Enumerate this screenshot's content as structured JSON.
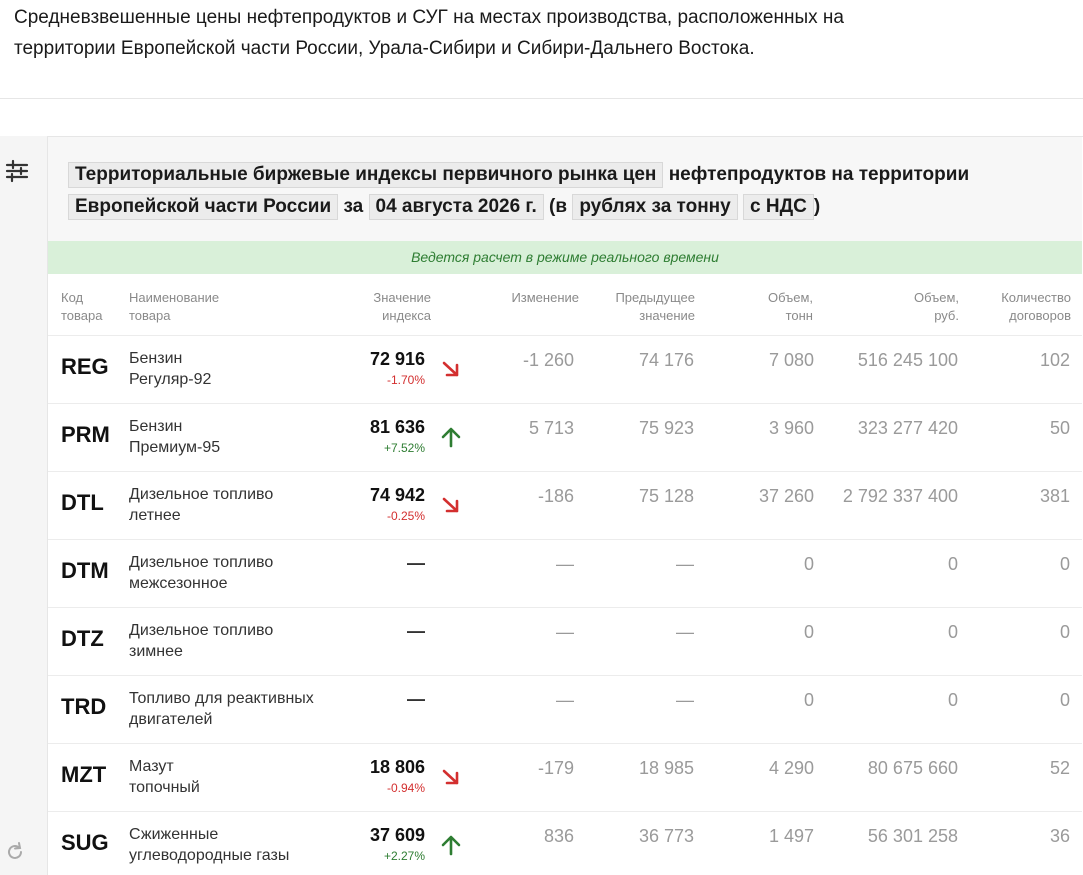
{
  "intro": {
    "line1": "Средневзвешенные цены нефтепродуктов и СУГ на местах производства, расположенных на",
    "line2": "территории Европейской части России, Урала-Сибири и Сибири-Дальнего Востока."
  },
  "icons": {
    "filter": "sliders-icon",
    "refresh": "refresh-icon"
  },
  "title": {
    "index_select": "Территориальные биржевые индексы первичного рынка цен",
    "text_middle": "нефтепродуктов на территории",
    "region_select": "Европейской части России",
    "text_za": "за",
    "date_select": "04 августа 2026 г.",
    "paren_open": "(в",
    "unit_select": "рублях за тонну",
    "vat_select": "с НДС",
    "paren_close": ")"
  },
  "banner": "Ведется расчет в режиме реального времени",
  "columns": {
    "code": [
      "Код",
      "товара"
    ],
    "name": [
      "Наименование",
      "товара"
    ],
    "index": [
      "Значение",
      "индекса"
    ],
    "change": [
      "Изменение",
      ""
    ],
    "prev": [
      "Предыдущее",
      "значение"
    ],
    "vol_t": [
      "Объем,",
      "тонн"
    ],
    "vol_rub": [
      "Объем,",
      "руб."
    ],
    "contracts": [
      "Количество",
      "договоров"
    ]
  },
  "colors": {
    "up": "#2e7d32",
    "down": "#d32f2f",
    "banner_bg": "#d9f0d9"
  },
  "rows": [
    {
      "code": "REG",
      "name1": "Бензин",
      "name2": "Регуляр-92",
      "value": "72 916",
      "pct": "-1.70%",
      "trend": "down",
      "change": "-1 260",
      "prev": "74 176",
      "vol_t": "7 080",
      "vol_rub": "516 245 100",
      "contracts": "102"
    },
    {
      "code": "PRM",
      "name1": "Бензин",
      "name2": "Премиум-95",
      "value": "81 636",
      "pct": "+7.52%",
      "trend": "up",
      "change": "5 713",
      "prev": "75 923",
      "vol_t": "3 960",
      "vol_rub": "323 277 420",
      "contracts": "50"
    },
    {
      "code": "DTL",
      "name1": "Дизельное топливо",
      "name2": "летнее",
      "value": "74 942",
      "pct": "-0.25%",
      "trend": "down",
      "change": "-186",
      "prev": "75 128",
      "vol_t": "37 260",
      "vol_rub": "2 792 337 400",
      "contracts": "381"
    },
    {
      "code": "DTM",
      "name1": "Дизельное топливо",
      "name2": "межсезонное",
      "value": "—",
      "pct": "",
      "trend": "none",
      "change": "—",
      "prev": "—",
      "vol_t": "0",
      "vol_rub": "0",
      "contracts": "0"
    },
    {
      "code": "DTZ",
      "name1": "Дизельное топливо",
      "name2": "зимнее",
      "value": "—",
      "pct": "",
      "trend": "none",
      "change": "—",
      "prev": "—",
      "vol_t": "0",
      "vol_rub": "0",
      "contracts": "0"
    },
    {
      "code": "TRD",
      "name1": "Топливо для реактивных",
      "name2": "двигателей",
      "value": "—",
      "pct": "",
      "trend": "none",
      "change": "—",
      "prev": "—",
      "vol_t": "0",
      "vol_rub": "0",
      "contracts": "0"
    },
    {
      "code": "MZT",
      "name1": "Мазут",
      "name2": "топочный",
      "value": "18 806",
      "pct": "-0.94%",
      "trend": "down",
      "change": "-179",
      "prev": "18 985",
      "vol_t": "4 290",
      "vol_rub": "80 675 660",
      "contracts": "52"
    },
    {
      "code": "SUG",
      "name1": "Сжиженные",
      "name2": "углеводородные газы",
      "value": "37 609",
      "pct": "+2.27%",
      "trend": "up",
      "change": "836",
      "prev": "36 773",
      "vol_t": "1 497",
      "vol_rub": "56 301 258",
      "contracts": "36"
    }
  ]
}
